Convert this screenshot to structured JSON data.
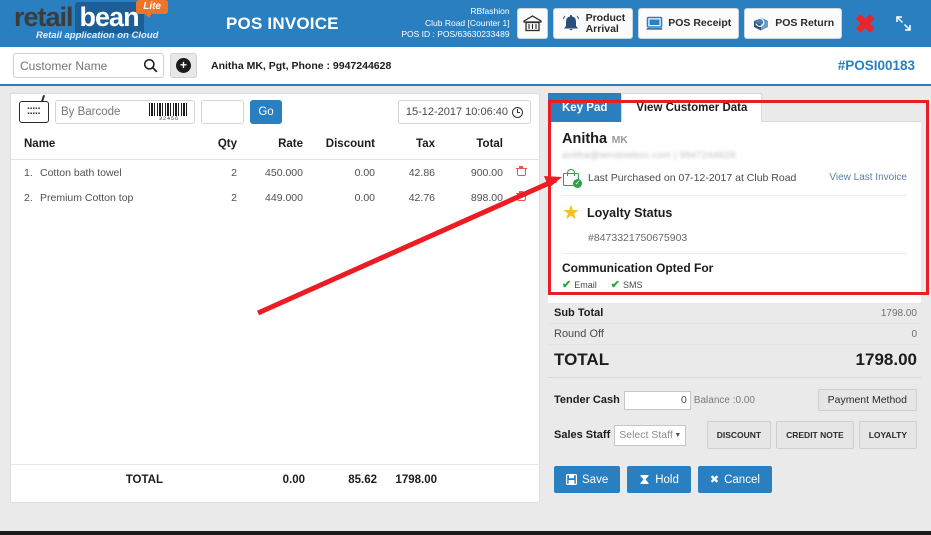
{
  "header": {
    "logo": {
      "part1": "retail",
      "part2": "bean",
      "badge": "Lite",
      "tagline": "Retail application on Cloud"
    },
    "title": "POS INVOICE",
    "store": {
      "name": "RBfashion",
      "counter": "Club Road [Counter 1]",
      "pos_id": "POS ID : POS/63630233489"
    },
    "buttons": [
      {
        "name": "store-icon-button",
        "label": ""
      },
      {
        "name": "product-arrival-button",
        "label_line1": "Product",
        "label_line2": "Arrival"
      },
      {
        "name": "pos-receipt-button",
        "label": "POS Receipt"
      },
      {
        "name": "pos-return-button",
        "label": "POS Return"
      },
      {
        "name": "close-button",
        "label": "✖"
      },
      {
        "name": "fullscreen-button",
        "label": "⤧"
      }
    ]
  },
  "customer_bar": {
    "search_placeholder": "Customer Name",
    "search_value": "",
    "add_label": "+",
    "customer_detail": "Anitha MK, Pgt, Phone : 9947244628",
    "invoice_no": "#POSI00183"
  },
  "barcode_bar": {
    "barcode_placeholder": "By Barcode",
    "barcode_value": "",
    "barcode_digits": "32456",
    "qty_value": "",
    "go_label": "Go",
    "datetime": "15-12-2017 10:06:40"
  },
  "items_table": {
    "headers": [
      "Name",
      "Qty",
      "Rate",
      "Discount",
      "Tax",
      "Total"
    ],
    "rows": [
      {
        "idx": "1.",
        "name": "Cotton bath towel",
        "qty": "2",
        "rate": "450.000",
        "discount": "0.00",
        "tax": "42.86",
        "total": "900.00"
      },
      {
        "idx": "2.",
        "name": "Premium Cotton top",
        "qty": "2",
        "rate": "449.000",
        "discount": "0.00",
        "tax": "42.76",
        "total": "898.00"
      }
    ],
    "footer": {
      "label": "TOTAL",
      "discount": "0.00",
      "tax": "85.62",
      "total": "1798.00"
    }
  },
  "right_panel": {
    "tabs": [
      {
        "label": "Key Pad",
        "active": false
      },
      {
        "label": "View Customer Data",
        "active": true
      }
    ],
    "customer": {
      "first_name": "Anitha",
      "last_name": "MK",
      "contact_masked": "anitha@windowbox.com | 9947244628",
      "last_purchased": "Last Purchased on 07-12-2017 at Club Road",
      "view_last_invoice": "View Last Invoice"
    },
    "loyalty": {
      "title": "Loyalty Status",
      "number": "#8473321750675903"
    },
    "communication": {
      "title": "Communication Opted For",
      "options": [
        {
          "label": "Email",
          "checked": true
        },
        {
          "label": "SMS",
          "checked": true
        }
      ]
    }
  },
  "summary": {
    "sub_total_label": "Sub Total",
    "sub_total_value": "1798.00",
    "round_off_label": "Round Off",
    "round_off_value": "0",
    "total_label": "TOTAL",
    "total_value": "1798.00",
    "tender_cash_label": "Tender Cash",
    "tender_cash_value": "0",
    "balance_label": "Balance :0.00",
    "payment_method_label": "Payment Method",
    "sales_staff_label": "Sales Staff",
    "sales_staff_value": "Select Staff",
    "mini_buttons": [
      "DISCOUNT",
      "CREDIT NOTE",
      "LOYALTY"
    ],
    "actions": [
      {
        "label": "Save",
        "icon": "💾"
      },
      {
        "label": "Hold",
        "icon": "⧖"
      },
      {
        "label": "Cancel",
        "icon": "✖"
      }
    ]
  },
  "annotations": {
    "highlight_color": "#ec1c24",
    "arrow_color": "#ec1c24"
  }
}
